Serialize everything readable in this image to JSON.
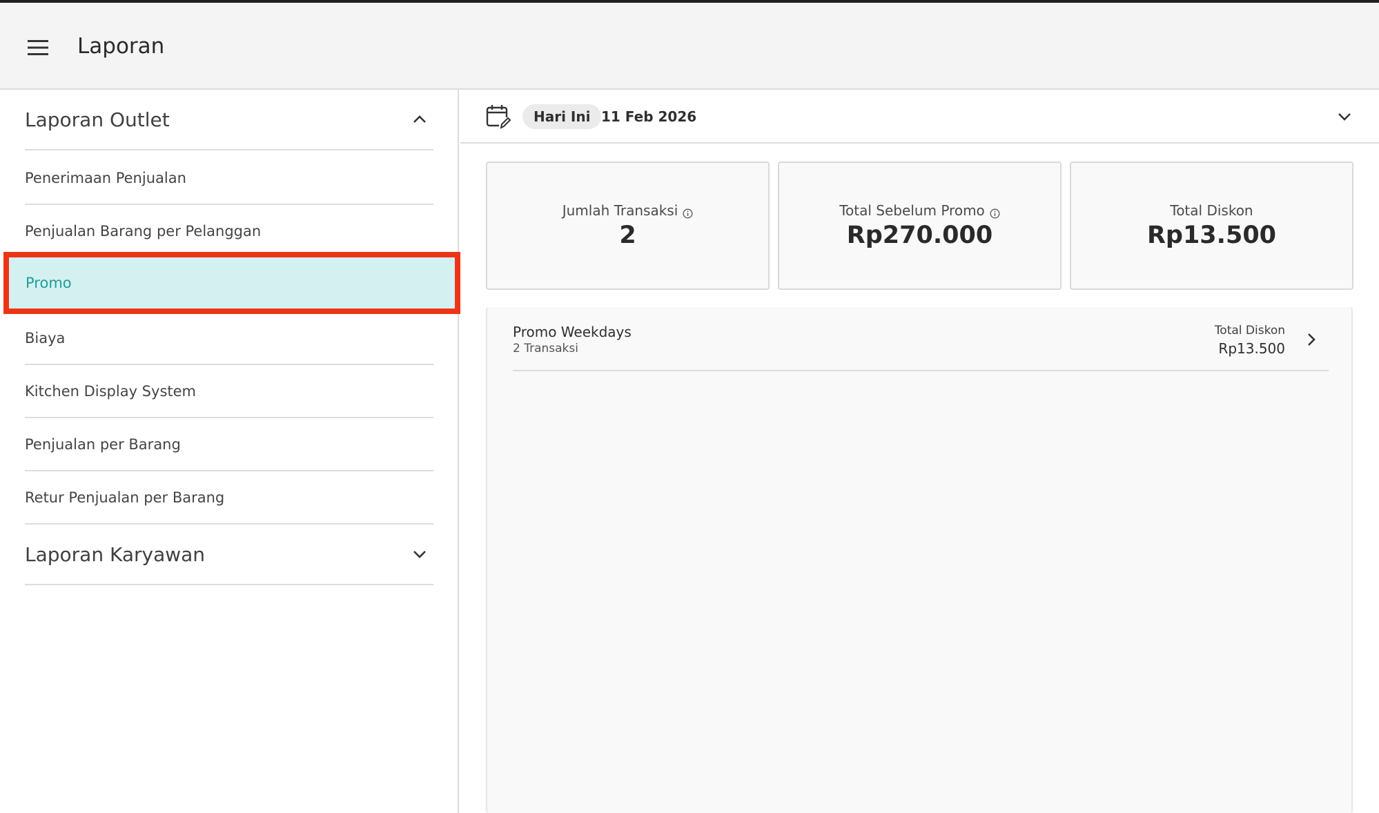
{
  "appbar": {
    "title": "Laporan",
    "menu_icon": "hamburger-menu-icon"
  },
  "sidebar": {
    "outlet_section": {
      "title": "Laporan Outlet",
      "expanded": true,
      "icon": "chevron-up-icon"
    },
    "items": [
      {
        "label": "Penerimaan Penjualan"
      },
      {
        "label": "Penjualan Barang per Pelanggan"
      },
      {
        "label": "Promo",
        "active": true
      },
      {
        "label": "Biaya"
      },
      {
        "label": "Kitchen Display System"
      },
      {
        "label": "Penjualan per Barang"
      },
      {
        "label": "Retur Penjualan per Barang"
      }
    ],
    "employee_section": {
      "title": "Laporan Karyawan",
      "expanded": false,
      "icon": "chevron-down-icon"
    }
  },
  "datebar": {
    "icon": "calendar-edit-icon",
    "chip": "Hari Ini",
    "date": "11 Feb 2026"
  },
  "stats": [
    {
      "label": "Jumlah Transaksi",
      "value": "2",
      "info": true
    },
    {
      "label": "Total Sebelum Promo",
      "value": "Rp270.000",
      "info": true
    },
    {
      "label": "Total Diskon",
      "value": "Rp13.500",
      "info": false
    }
  ],
  "promos": [
    {
      "name": "Promo Weekdays",
      "transactions": "2 Transaksi",
      "total_label": "Total Diskon",
      "total_value": "Rp13.500"
    }
  ],
  "colors": {
    "accent": "#1c9e9b",
    "active_bg": "#d5f0f0",
    "highlight_border": "#ec3517"
  }
}
